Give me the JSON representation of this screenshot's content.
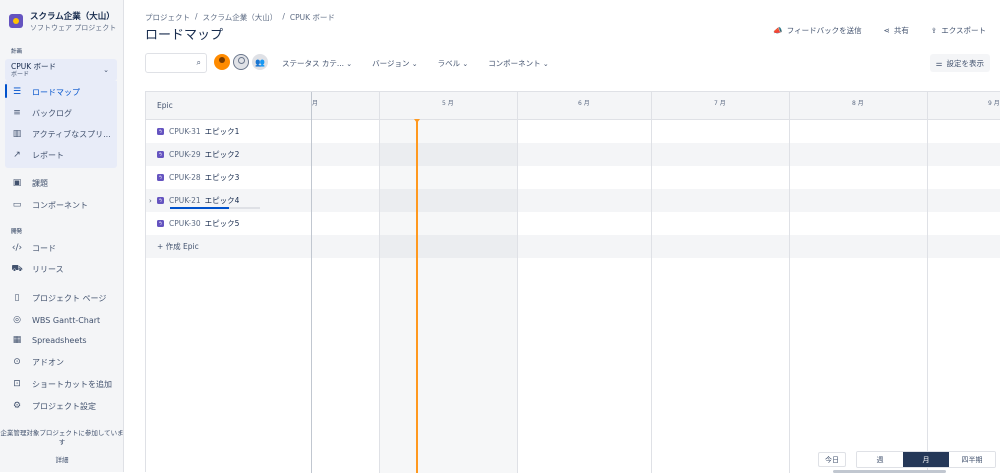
{
  "project": {
    "name": "スクラム企業（大山）",
    "type": "ソフトウェア プロジェクト"
  },
  "sidebar": {
    "section_plan": "計画",
    "board": {
      "title": "CPUK ボード",
      "subtitle": "ボード"
    },
    "plan_items": [
      {
        "label": "ロードマップ",
        "icon": "roadmap-icon"
      },
      {
        "label": "バックログ",
        "icon": "backlog-icon"
      },
      {
        "label": "アクティブなスプリ...",
        "icon": "sprint-board-icon"
      },
      {
        "label": "レポート",
        "icon": "report-icon"
      }
    ],
    "issues": "課題",
    "components": "コンポーネント",
    "section_dev": "開発",
    "code": "コード",
    "releases": "リリース",
    "others": [
      {
        "label": "プロジェクト ページ",
        "icon": "page-icon"
      },
      {
        "label": "WBS Gantt-Chart",
        "icon": "gantt-icon"
      },
      {
        "label": "Spreadsheets",
        "icon": "spreadsheet-icon"
      },
      {
        "label": "アドオン",
        "icon": "addon-icon"
      },
      {
        "label": "ショートカットを追加",
        "icon": "add-shortcut-icon"
      },
      {
        "label": "プロジェクト設定",
        "icon": "settings-icon"
      }
    ],
    "footer_note": "企業管理対象プロジェクトに参加しています",
    "footer_detail": "詳細"
  },
  "header": {
    "breadcrumb": [
      "プロジェクト",
      "/",
      "スクラム企業（大山）",
      "/",
      "CPUK ボード"
    ],
    "title": "ロードマップ",
    "feedback": "フィードバックを送信",
    "share": "共有",
    "export": "エクスポート"
  },
  "toolbar": {
    "search_placeholder": "",
    "filters": [
      "ステータス カテ...",
      "バージョン",
      "ラベル",
      "コンポーネント"
    ],
    "settings": "設定を表示"
  },
  "roadmap": {
    "epic_header": "Epic",
    "epics": [
      {
        "key": "CPUK-31",
        "name": "エピック1"
      },
      {
        "key": "CPUK-29",
        "name": "エピック2"
      },
      {
        "key": "CPUK-28",
        "name": "エピック3"
      },
      {
        "key": "CPUK-21",
        "name": "エピック4",
        "progress": 0.66
      },
      {
        "key": "CPUK-30",
        "name": "エピック5"
      }
    ],
    "create_epic": "+ 作成 Epic",
    "months": [
      "月",
      "5 月",
      "6 月",
      "7 月",
      "8 月",
      "9 月"
    ],
    "zoom": {
      "today": "今日",
      "week": "週",
      "month": "月",
      "quarter": "四半期",
      "selected": "月"
    }
  }
}
